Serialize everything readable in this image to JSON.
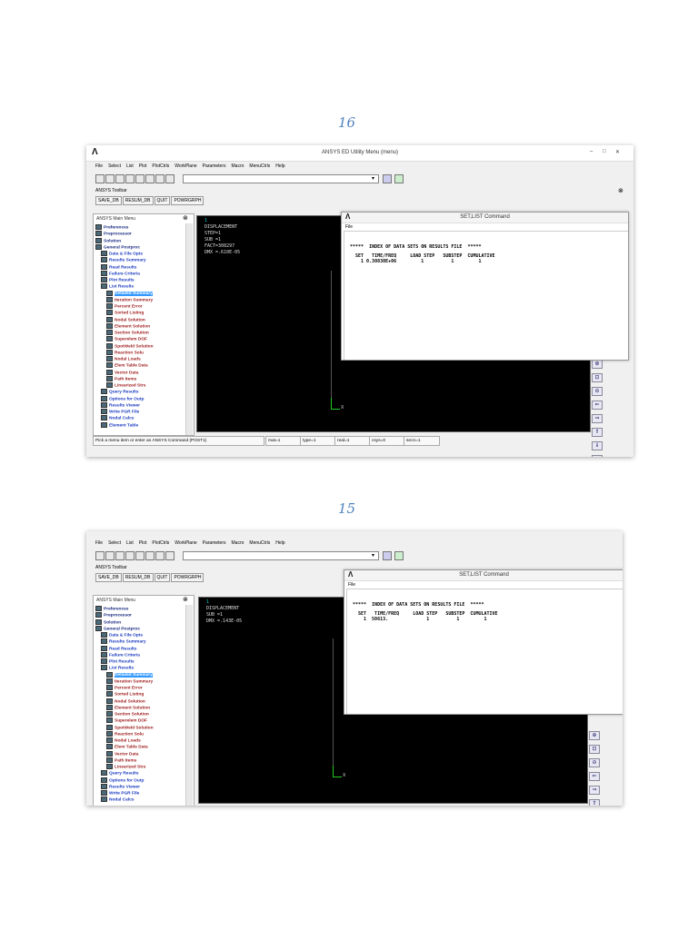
{
  "page_numbers": [
    "16",
    "15"
  ],
  "shots": [
    {
      "title": "ANSYS ED Utility Menu (menu)",
      "logo": "Λ",
      "window_controls": [
        "–",
        "□",
        "✕"
      ],
      "menu": [
        "File",
        "Select",
        "List",
        "Plot",
        "PlotCtrls",
        "WorkPlane",
        "Parameters",
        "Macro",
        "MenuCtrls",
        "Help"
      ],
      "toolbar_label": "ANSYS Toolbar",
      "toolbar_buttons": [
        "SAVE_DB",
        "RESUM_DB",
        "QUIT",
        "POWRGRPH"
      ],
      "main_menu_title": "ANSYS Main Menu",
      "menu_items": [
        {
          "label": "Preferences",
          "level": 0
        },
        {
          "label": "Preprocessor",
          "level": 0
        },
        {
          "label": "Solution",
          "level": 0
        },
        {
          "label": "General Postproc",
          "level": 0
        },
        {
          "label": "Data & File Opts",
          "level": 1
        },
        {
          "label": "Results Summary",
          "level": 1
        },
        {
          "label": "Read Results",
          "level": 1
        },
        {
          "label": "Failure Criteria",
          "level": 1
        },
        {
          "label": "Plot Results",
          "level": 1
        },
        {
          "label": "List Results",
          "level": 1
        },
        {
          "label": "Detailed Summary",
          "level": 2,
          "selected": true
        },
        {
          "label": "Iteration Summary",
          "level": 2
        },
        {
          "label": "Percent Error",
          "level": 2
        },
        {
          "label": "Sorted Listing",
          "level": 2
        },
        {
          "label": "Nodal Solution",
          "level": 2
        },
        {
          "label": "Element Solution",
          "level": 2
        },
        {
          "label": "Section Solution",
          "level": 2
        },
        {
          "label": "Superelem DOF",
          "level": 2
        },
        {
          "label": "SpotWeld Solution",
          "level": 2
        },
        {
          "label": "Reaction Solu",
          "level": 2
        },
        {
          "label": "Nodal Loads",
          "level": 2
        },
        {
          "label": "Elem Table Data",
          "level": 2
        },
        {
          "label": "Vector Data",
          "level": 2
        },
        {
          "label": "Path Items",
          "level": 2
        },
        {
          "label": "Linearized Strs",
          "level": 2
        },
        {
          "label": "Query Results",
          "level": 1
        },
        {
          "label": "Options for Outp",
          "level": 1
        },
        {
          "label": "Results Viewer",
          "level": 1
        },
        {
          "label": "Write PGR File",
          "level": 1
        },
        {
          "label": "Nodal Calcs",
          "level": 1
        },
        {
          "label": "Element Table",
          "level": 1
        }
      ],
      "graphics_lines": [
        "1",
        "DISPLACEMENT",
        "",
        "STEP=1",
        "SUB =1",
        "FACT=308297",
        "DMX =.610E-05"
      ],
      "axis_label": "X",
      "setlist": {
        "title": "SET,LIST Command",
        "file_menu": "File",
        "header": "*****  INDEX OF DATA SETS ON RESULTS FILE  *****",
        "columns": "SET   TIME/FREQ     LOAD STEP   SUBSTEP  CUMULATIVE",
        "row": "  1 0.30830E+06         1          1         1"
      },
      "status": {
        "prompt": "Pick a menu item or enter an ANSYS Command (POST1)",
        "mat": "mat=1",
        "type": "type=1",
        "real": "real=1",
        "csys": "csys=0",
        "secn": "secn=1"
      }
    },
    {
      "logo": "Λ",
      "menu": [
        "File",
        "Select",
        "List",
        "Plot",
        "PlotCtrls",
        "WorkPlane",
        "Parameters",
        "Macro",
        "MenuCtrls",
        "Help"
      ],
      "toolbar_label": "ANSYS Toolbar",
      "toolbar_buttons": [
        "SAVE_DB",
        "RESUM_DB",
        "QUIT",
        "POWRGRPH"
      ],
      "main_menu_title": "ANSYS Main Menu",
      "menu_items": [
        {
          "label": "Preferences",
          "level": 0
        },
        {
          "label": "Preprocessor",
          "level": 0
        },
        {
          "label": "Solution",
          "level": 0
        },
        {
          "label": "General Postproc",
          "level": 0
        },
        {
          "label": "Data & File Opts",
          "level": 1
        },
        {
          "label": "Results Summary",
          "level": 1
        },
        {
          "label": "Read Results",
          "level": 1
        },
        {
          "label": "Failure Criteria",
          "level": 1
        },
        {
          "label": "Plot Results",
          "level": 1
        },
        {
          "label": "List Results",
          "level": 1
        },
        {
          "label": "Detailed Summary",
          "level": 2,
          "selected": true
        },
        {
          "label": "Iteration Summary",
          "level": 2
        },
        {
          "label": "Percent Error",
          "level": 2
        },
        {
          "label": "Sorted Listing",
          "level": 2
        },
        {
          "label": "Nodal Solution",
          "level": 2
        },
        {
          "label": "Element Solution",
          "level": 2
        },
        {
          "label": "Section Solution",
          "level": 2
        },
        {
          "label": "Superelem DOF",
          "level": 2
        },
        {
          "label": "SpotWeld Solution",
          "level": 2
        },
        {
          "label": "Reaction Solu",
          "level": 2
        },
        {
          "label": "Nodal Loads",
          "level": 2
        },
        {
          "label": "Elem Table Data",
          "level": 2
        },
        {
          "label": "Vector Data",
          "level": 2
        },
        {
          "label": "Path Items",
          "level": 2
        },
        {
          "label": "Linearized Strs",
          "level": 2
        },
        {
          "label": "Query Results",
          "level": 1
        },
        {
          "label": "Options for Outp",
          "level": 1
        },
        {
          "label": "Results Viewer",
          "level": 1
        },
        {
          "label": "Write PGR File",
          "level": 1
        },
        {
          "label": "Nodal Calcs",
          "level": 1
        }
      ],
      "graphics_lines": [
        "1",
        "DISPLACEMENT",
        "",
        "SUB =1",
        "DMX =.143E-05"
      ],
      "axis_label": "X",
      "setlist": {
        "title": "SET,LIST Command",
        "file_menu": "File",
        "header": "*****  INDEX OF DATA SETS ON RESULTS FILE  *****",
        "columns": "SET   TIME/FREQ     LOAD STEP   SUBSTEP  CUMULATIVE",
        "row": "  1  50613.              1          1         1"
      }
    }
  ]
}
